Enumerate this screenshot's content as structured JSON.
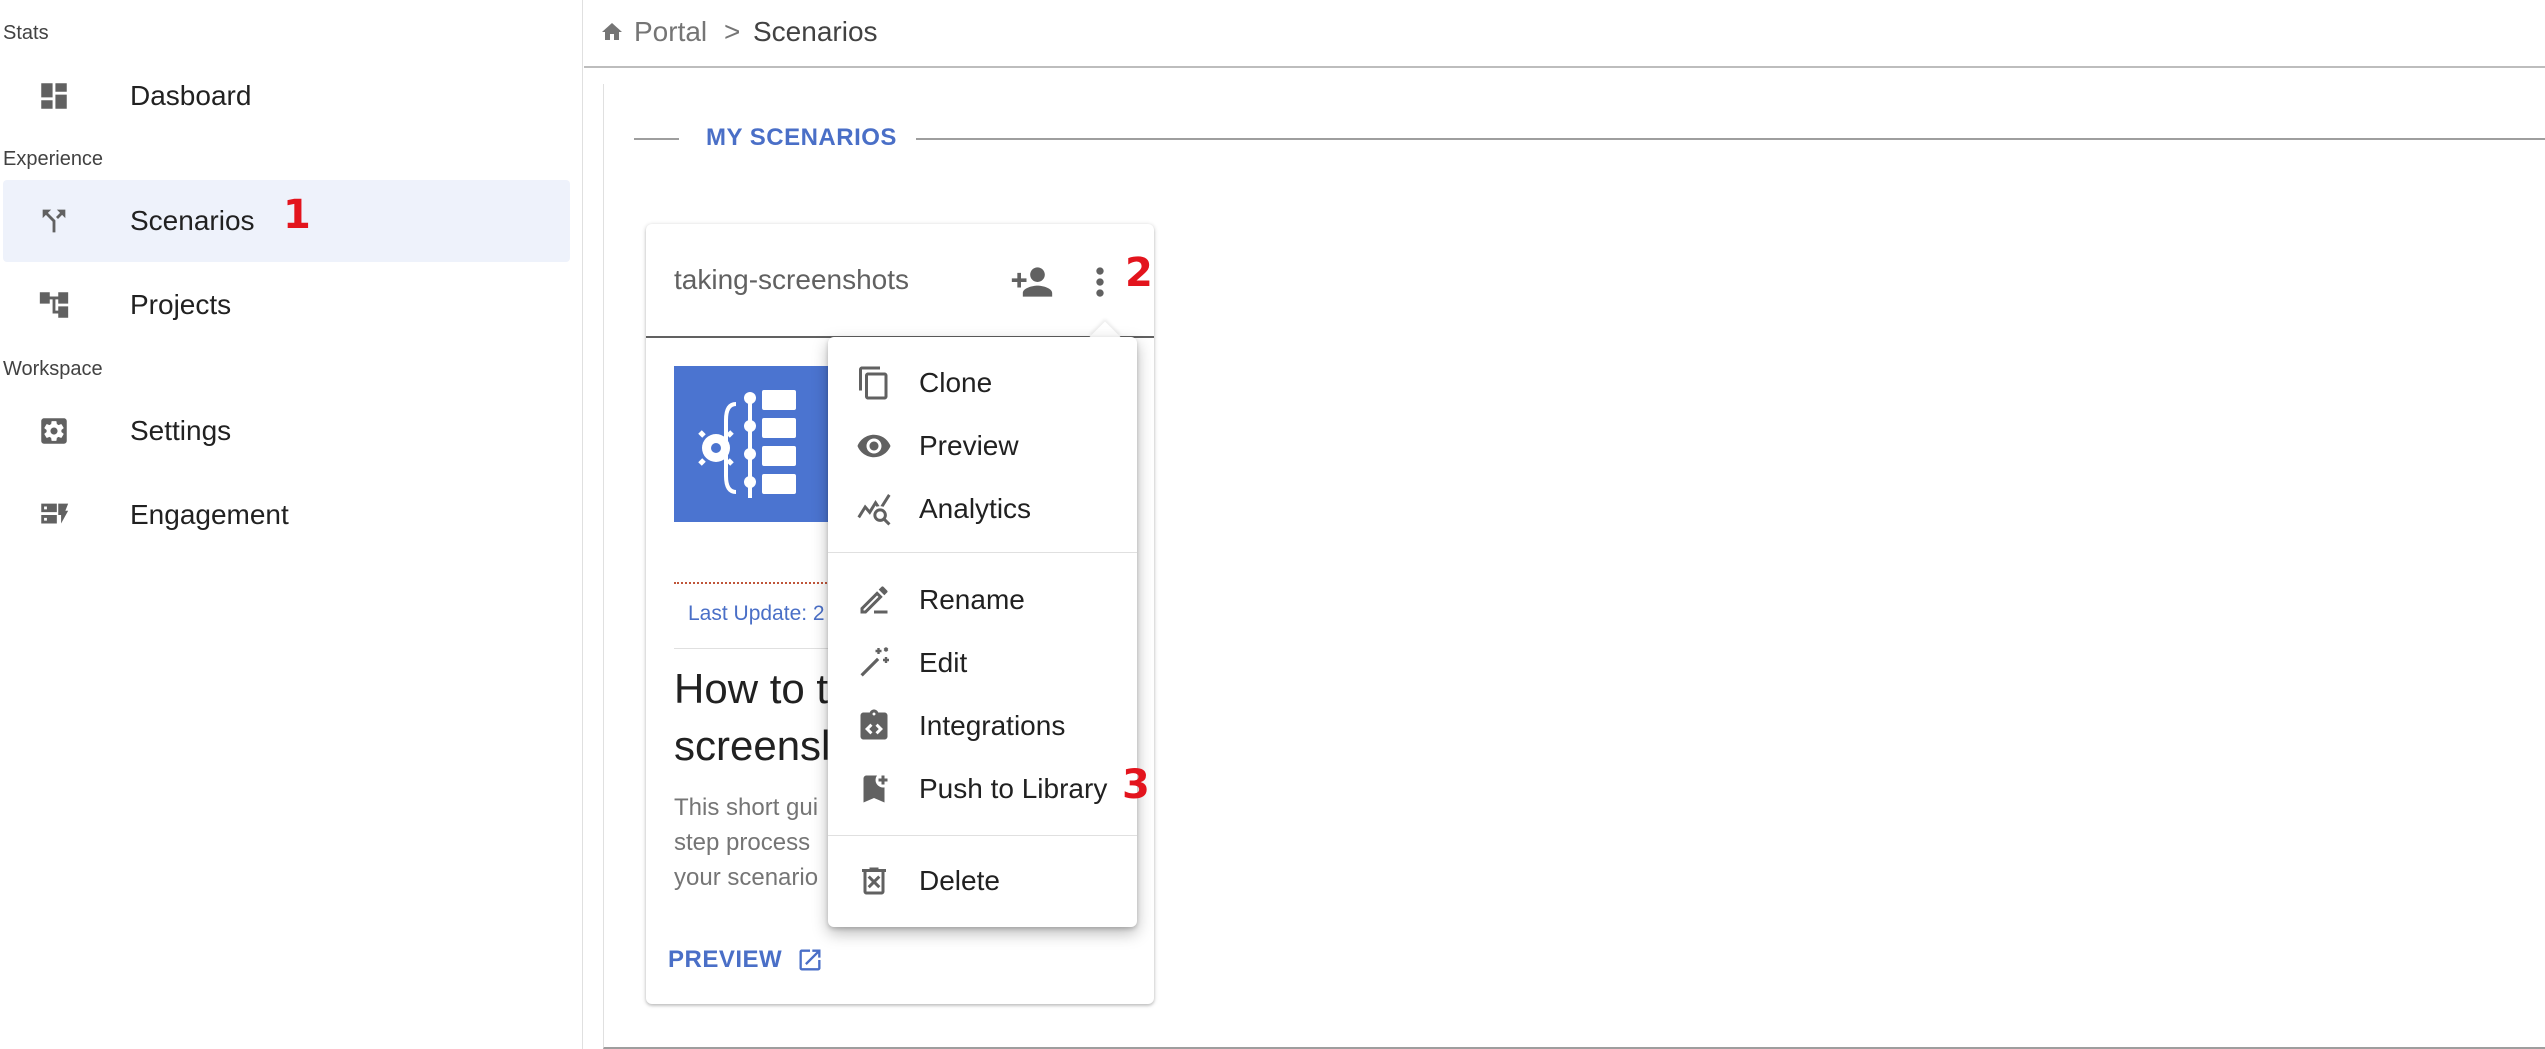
{
  "sidebar": {
    "sections": {
      "stats": "Stats",
      "experience": "Experience",
      "workspace": "Workspace"
    },
    "items": [
      {
        "label": "Dasboard",
        "icon": "dashboard-icon"
      },
      {
        "label": "Scenarios",
        "icon": "scenarios-icon",
        "active": true
      },
      {
        "label": "Projects",
        "icon": "projects-icon"
      },
      {
        "label": "Settings",
        "icon": "settings-icon"
      },
      {
        "label": "Engagement",
        "icon": "engagement-icon"
      }
    ]
  },
  "breadcrumb": {
    "home_icon": "home-icon",
    "portal": "Portal",
    "separator": ">",
    "current": "Scenarios"
  },
  "main": {
    "section_title": "MY SCENARIOS"
  },
  "card": {
    "name": "taking-screenshots",
    "last_update": "Last Update: 2",
    "title": "How to t\nscreensl",
    "description": "This short gui\nstep process \nyour scenario",
    "preview_label": "PREVIEW"
  },
  "menu": {
    "items": [
      {
        "label": "Clone",
        "icon": "copy-icon"
      },
      {
        "label": "Preview",
        "icon": "eye-icon"
      },
      {
        "label": "Analytics",
        "icon": "analytics-icon"
      },
      {
        "label": "Rename",
        "icon": "pencil-icon"
      },
      {
        "label": "Edit",
        "icon": "magic-wand-icon"
      },
      {
        "label": "Integrations",
        "icon": "integrations-icon"
      },
      {
        "label": "Push to Library",
        "icon": "bookmark-add-icon"
      },
      {
        "label": "Delete",
        "icon": "delete-icon"
      }
    ]
  },
  "annotations": [
    "1",
    "2",
    "3"
  ],
  "colors": {
    "accent": "#4a6fc7",
    "active_bg": "#eef2fb",
    "thumb_bg": "#4b74d0",
    "marker": "#e3141d",
    "icon": "#616161"
  }
}
